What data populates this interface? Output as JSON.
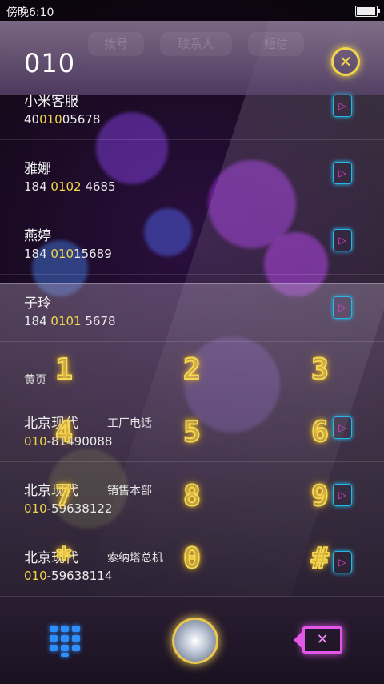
{
  "status": {
    "time": "傍晚6:10",
    "battery_level": 0.9
  },
  "header": {
    "dial_number": "010",
    "ghost_tabs": [
      "拨号",
      "联系人",
      "短信"
    ]
  },
  "icons": {
    "clear": "close-icon",
    "keypad": "keypad-grid-icon",
    "call": "diamond-call-icon",
    "delete": "backspace-icon"
  },
  "contacts": [
    {
      "name": "小米客服",
      "num_before": "40",
      "num_match": "010",
      "num_after": "05678"
    },
    {
      "name": "雅娜",
      "num_before": "184 ",
      "num_match": "0102",
      "num_after": " 4685"
    },
    {
      "name": "燕婷",
      "num_before": "184 ",
      "num_match": "010",
      "num_after": "15689"
    },
    {
      "name": "子玲",
      "num_before": "184 ",
      "num_match": "0101",
      "num_after": " 5678"
    }
  ],
  "yellow_pages": {
    "section_label": "黄页",
    "items": [
      {
        "name": "北京现代",
        "tag": "工厂电话",
        "num_match": "010",
        "num_after": "-81490088"
      },
      {
        "name": "北京现代",
        "tag": "销售本部",
        "num_match": "010",
        "num_after": "-59638122"
      },
      {
        "name": "北京现代",
        "tag": "索纳塔总机",
        "num_match": "010",
        "num_after": "-59638114"
      }
    ]
  },
  "keypad": [
    "1",
    "2",
    "3",
    "4",
    "5",
    "6",
    "7",
    "8",
    "9",
    "*",
    "0",
    "#"
  ],
  "colors": {
    "accent_yellow": "#f3d64a",
    "arrow_blue": "#22b8e8",
    "delete_pink": "#e256e8",
    "keypad_blue": "#2e8fff"
  }
}
